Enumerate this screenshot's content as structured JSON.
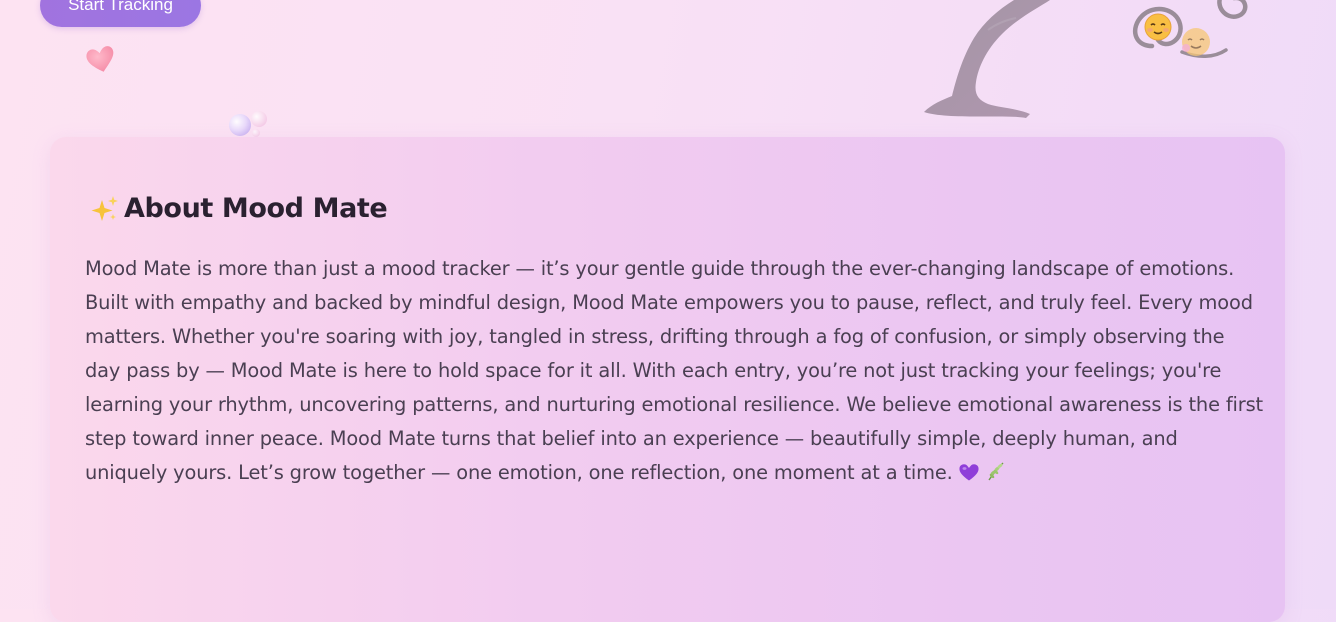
{
  "hero": {
    "cta_label": "Start Tracking"
  },
  "about": {
    "title": "About Mood Mate",
    "title_icon": "sparkles-icon",
    "body": "Mood Mate is more than just a mood tracker — it’s your gentle guide through the ever-changing landscape of emotions. Built with empathy and backed by mindful design, Mood Mate empowers you to pause, reflect, and truly feel. Every mood matters. Whether you're soaring with joy, tangled in stress, drifting through a fog of confusion, or simply observing the day pass by — Mood Mate is here to hold space for it all. With each entry, you’re not just tracking your feelings; you're learning your rhythm, uncovering patterns, and nurturing emotional resilience. We believe emotional awareness is the first step toward inner peace. Mood Mate turns that belief into an experience — beautifully simple, deeply human, and uniquely yours. Let’s grow together — one emotion, one reflection, one moment at a time.",
    "trailing_icons": [
      "purple-heart-icon",
      "herb-icon"
    ]
  },
  "colors": {
    "cta_background": "#9f74e0",
    "card_background_start": "#fbd8ec",
    "card_background_end": "#e7c3f3",
    "title_text": "#2a2130",
    "body_text": "#4a3f52"
  }
}
